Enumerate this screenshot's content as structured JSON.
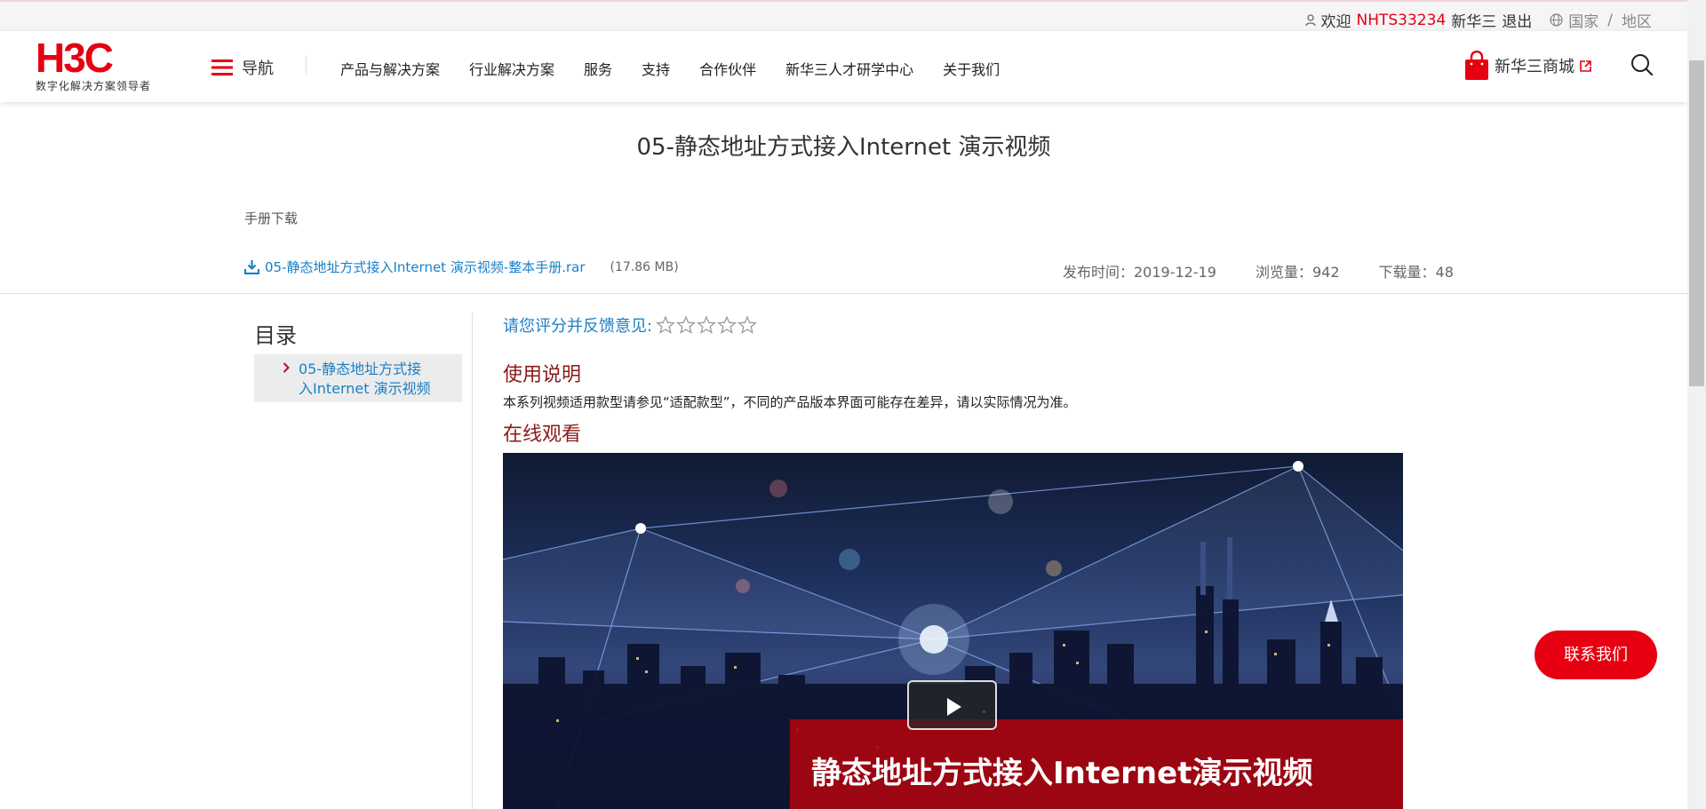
{
  "topbar": {
    "welcome": "欢迎",
    "username": "NHTS33234",
    "company": "新华三",
    "logout": "退出",
    "country": "国家",
    "slash": "/",
    "region": "地区"
  },
  "header": {
    "logo_text": "H3C",
    "slogan": "数字化解决方案领导者",
    "nav_toggle": "导航",
    "menu": [
      "产品与解决方案",
      "行业解决方案",
      "服务",
      "支持",
      "合作伙伴",
      "新华三人才研学中心",
      "关于我们"
    ],
    "mall": "新华三商城"
  },
  "document": {
    "title": "05-静态地址方式接入Internet 演示视频",
    "manual_label": "手册下载",
    "download_link": "05-静态地址方式接入Internet 演示视频-整本手册.rar",
    "download_size": "(17.86 MB)",
    "publish": "发布时间：2019-12-19",
    "views": "浏览量：942",
    "downloads": "下载量：48"
  },
  "toc": {
    "title": "目录",
    "item_line1": "05-静态地址方式接",
    "item_line2": "入Internet 演示视频"
  },
  "content": {
    "rating_prompt": "请您评分并反馈意见:",
    "stars_total": 5,
    "stars_filled": 0,
    "usage_heading": "使用说明",
    "usage_text": "本系列视频适用款型请参见“适配款型”，不同的产品版本界面可能存在差异，请以实际情况为准。",
    "online_heading": "在线观看",
    "video_caption": "静态地址方式接入Internet演示视频"
  },
  "contact_button": "联系我们",
  "colors": {
    "brand_red": "#e60012",
    "link_blue": "#1a80c8",
    "heading_red": "#8b1a1a"
  }
}
